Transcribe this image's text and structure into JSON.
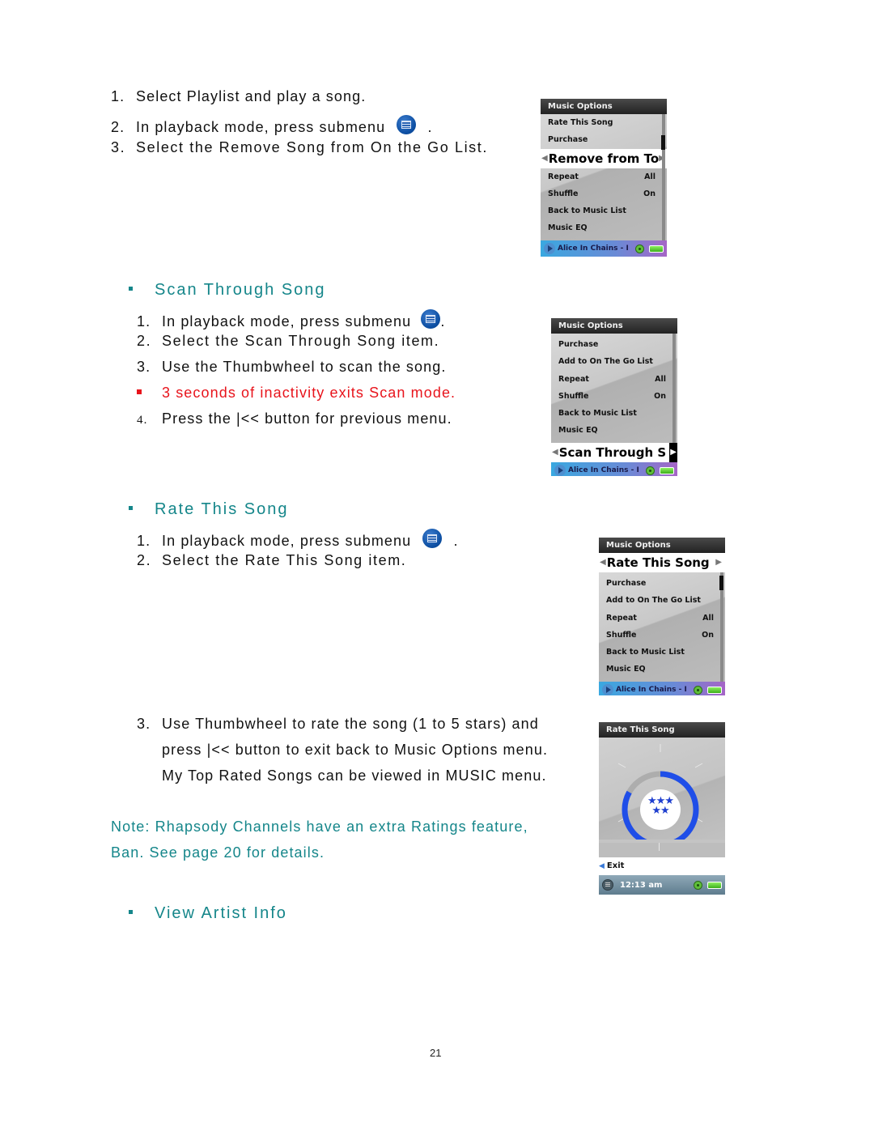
{
  "section_remove": {
    "steps": [
      {
        "num": "1.",
        "text": "Select Playlist and play a song."
      },
      {
        "num": "2.",
        "text": "In playback mode, press submenu",
        "suffix": "."
      },
      {
        "num": "3.",
        "text": "Select the Remove Song from On the Go List."
      }
    ],
    "screen": {
      "title": "Music Options",
      "items_before": [
        {
          "label": "Rate This Song",
          "value": ""
        },
        {
          "label": "Purchase",
          "value": ""
        }
      ],
      "selected": "Remove from To",
      "items_after": [
        {
          "label": "Repeat",
          "value": "All"
        },
        {
          "label": "Shuffle",
          "value": "On"
        },
        {
          "label": "Back to Music List",
          "value": ""
        },
        {
          "label": "Music EQ",
          "value": ""
        }
      ],
      "now_playing": "Alice In Chains - I"
    }
  },
  "section_scan": {
    "heading": "Scan Through Song",
    "steps": [
      {
        "num": "1.",
        "text": "In playback mode, press submenu",
        "suffix": "."
      },
      {
        "num": "2.",
        "text": "Select the Scan Through Song item."
      },
      {
        "num": "3.",
        "text": "Use the Thumbwheel to scan the song."
      }
    ],
    "warning": "3 seconds of inactivity exits Scan mode.",
    "step4": {
      "num": "4.",
      "text": "Press the |<< button for previous menu."
    },
    "screen": {
      "title": "Music Options",
      "items": [
        {
          "label": "Purchase",
          "value": ""
        },
        {
          "label": "Add to On The Go List",
          "value": ""
        },
        {
          "label": "Repeat",
          "value": "All"
        },
        {
          "label": "Shuffle",
          "value": "On"
        },
        {
          "label": "Back to Music List",
          "value": ""
        },
        {
          "label": "Music EQ",
          "value": ""
        }
      ],
      "selected": "Scan Through S",
      "now_playing": "Alice In Chains - I"
    }
  },
  "section_rate": {
    "heading": "Rate This Song",
    "steps": [
      {
        "num": "1.",
        "text": "In playback mode, press submenu",
        "suffix": "."
      },
      {
        "num": "2.",
        "text": "Select the Rate This Song item."
      }
    ],
    "step3": {
      "num": "3.",
      "lines": [
        "Use Thumbwheel to rate the song (1 to 5 stars) and",
        "press |<< button to exit back to Music Options menu.",
        "My Top Rated Songs can be viewed in MUSIC menu."
      ]
    },
    "note_lines": [
      "Note: Rhapsody Channels have an extra Ratings feature,",
      "Ban. See page 20 for details."
    ],
    "screen": {
      "title": "Music Options",
      "selected": "Rate This Song",
      "items": [
        {
          "label": "Purchase",
          "value": ""
        },
        {
          "label": "Add to On The Go List",
          "value": ""
        },
        {
          "label": "Repeat",
          "value": "All"
        },
        {
          "label": "Shuffle",
          "value": "On"
        },
        {
          "label": "Back to Music List",
          "value": ""
        },
        {
          "label": "Music EQ",
          "value": ""
        }
      ],
      "now_playing": "Alice In Chains - I"
    },
    "rating_screen": {
      "title": "Rate This Song",
      "stars": "★★★\n★★",
      "rating_value": 5,
      "rating_max": 5,
      "exit_label": "Exit",
      "time": "12:13 am"
    }
  },
  "section_artist": {
    "heading": "View Artist Info"
  },
  "footer": {
    "page_number": "21"
  },
  "colors": {
    "heading": "#15868a",
    "warning": "#e8141c",
    "note": "#15868a",
    "rating_ring": "#1f4ee8"
  }
}
